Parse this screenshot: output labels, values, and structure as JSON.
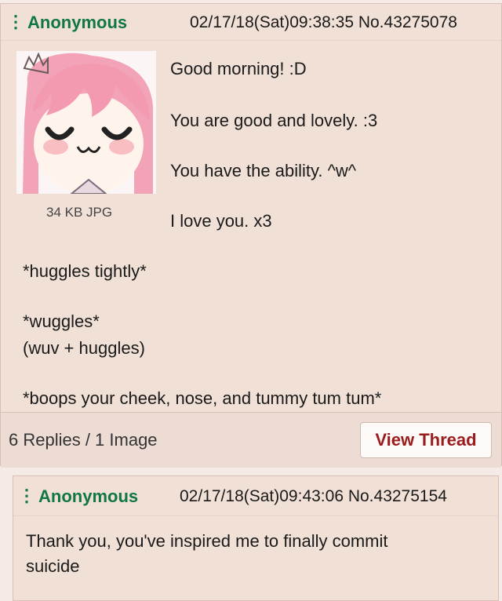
{
  "op": {
    "name": "Anonymous",
    "datetime_no": "02/17/18(Sat)09:38:35 No.43275078",
    "file_info": "34 KB JPG",
    "lines": [
      "Good morning! :D",
      "You are good and lovely. :3",
      "You have the ability. ^w^",
      "I love you. x3",
      "*huggles tightly*",
      "*wuggles*",
      "(wuv + huggles)",
      "*boops your cheek, nose, and tummy tum tum*"
    ],
    "replies_summary": "6 Replies / 1 Image",
    "view_thread_label": "View Thread"
  },
  "reply": {
    "name": "Anonymous",
    "datetime_no": "02/17/18(Sat)09:43:06 No.43275154",
    "lines": [
      "Thank you, you've inspired me to finally commit",
      "suicide"
    ]
  },
  "colors": {
    "name_green": "#117743",
    "post_bg": "#f0e0d6",
    "button_text": "#9a1c1c"
  }
}
